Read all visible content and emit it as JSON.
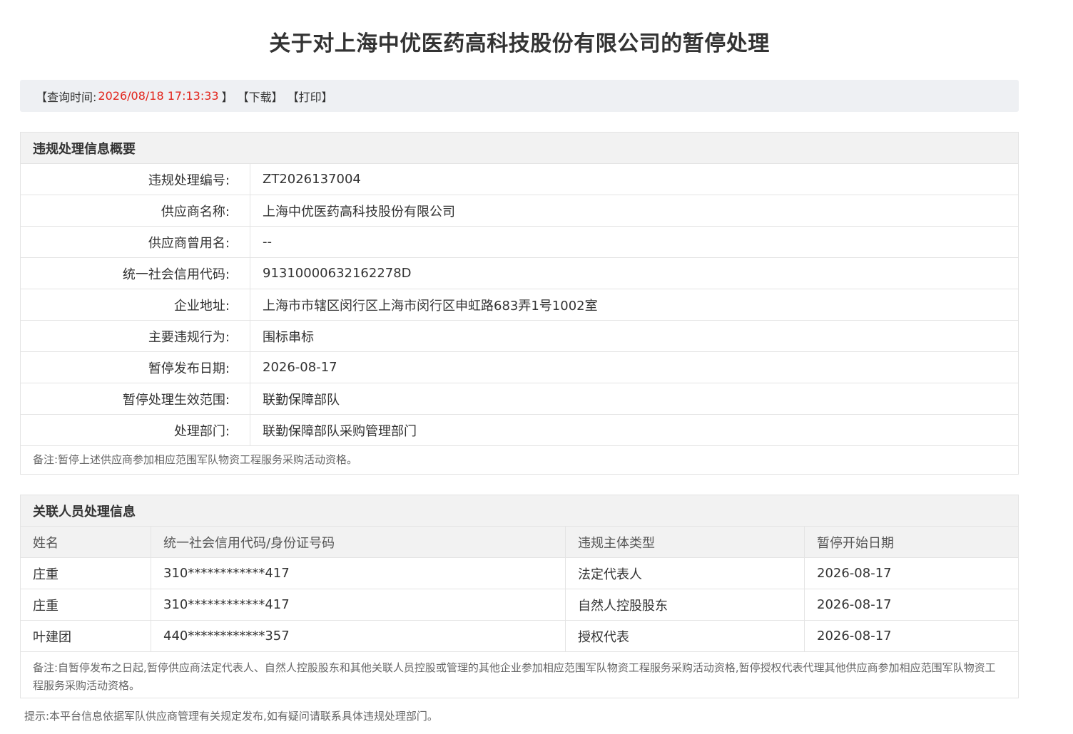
{
  "title": "关于对上海中优医药高科技股份有限公司的暂停处理",
  "query": {
    "prefix": "【查询时间:",
    "time": "2026/08/18 17:13:33",
    "suffix": "】",
    "download": "【下载】",
    "print": "【打印】"
  },
  "summary": {
    "header": "违规处理信息概要",
    "rows": [
      {
        "label": "违规处理编号:",
        "value": "ZT2026137004"
      },
      {
        "label": "供应商名称:",
        "value": "上海中优医药高科技股份有限公司"
      },
      {
        "label": "供应商曾用名:",
        "value": "--"
      },
      {
        "label": "统一社会信用代码:",
        "value": "91310000632162278D"
      },
      {
        "label": "企业地址:",
        "value": "上海市市辖区闵行区上海市闵行区申虹路683弄1号1002室"
      },
      {
        "label": "主要违规行为:",
        "value": "围标串标"
      },
      {
        "label": "暂停发布日期:",
        "value": "2026-08-17"
      },
      {
        "label": "暂停处理生效范围:",
        "value": "联勤保障部队"
      },
      {
        "label": "处理部门:",
        "value": "联勤保障部队采购管理部门"
      }
    ],
    "note": "备注:暂停上述供应商参加相应范围军队物资工程服务采购活动资格。"
  },
  "related": {
    "header": "关联人员处理信息",
    "columns": [
      "姓名",
      "统一社会信用代码/身份证号码",
      "违规主体类型",
      "暂停开始日期"
    ],
    "rows": [
      [
        "庄重",
        "310************417",
        "法定代表人",
        "2026-08-17"
      ],
      [
        "庄重",
        "310************417",
        "自然人控股股东",
        "2026-08-17"
      ],
      [
        "叶建团",
        "440************357",
        "授权代表",
        "2026-08-17"
      ]
    ],
    "note": "备注:自暂停发布之日起,暂停供应商法定代表人、自然人控股股东和其他关联人员控股或管理的其他企业参加相应范围军队物资工程服务采购活动资格,暂停授权代表代理其他供应商参加相应范围军队物资工程服务采购活动资格。"
  },
  "footer_tip": "提示:本平台信息依据军队供应商管理有关规定发布,如有疑问请联系具体违规处理部门。"
}
